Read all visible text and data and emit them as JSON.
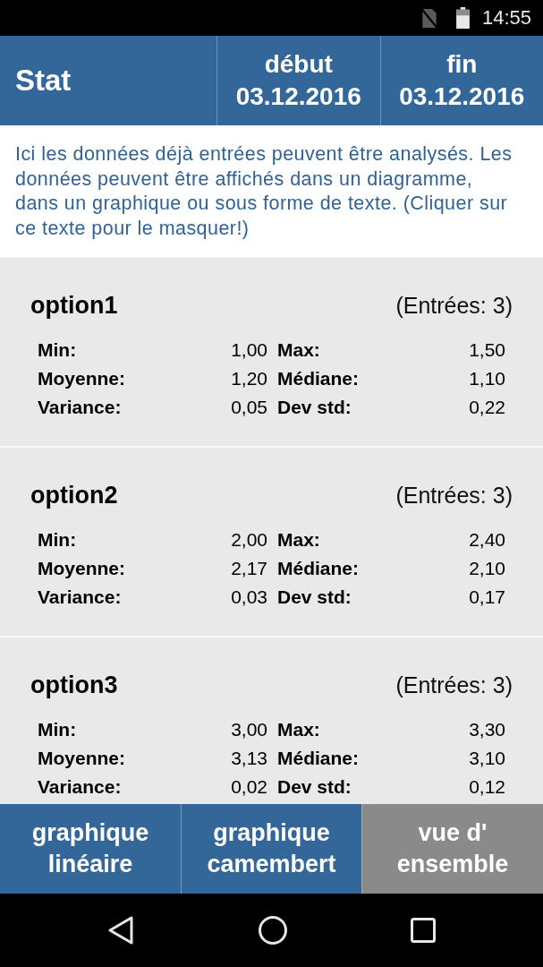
{
  "status_bar": {
    "time": "14:55"
  },
  "header": {
    "title": "Stat",
    "columns": [
      {
        "label": "début",
        "date": "03.12.2016"
      },
      {
        "label": "fin",
        "date": "03.12.2016"
      }
    ]
  },
  "info_text": "Ici les données déjà entrées peuvent être analysés. Les données peuvent être affichés dans un diagramme, dans un graphique ou sous forme de texte. (Cliquer sur ce texte pour le masquer!)",
  "options": [
    {
      "name": "option1",
      "entries": "(Entrées: 3)",
      "stats": [
        {
          "label": "Min:",
          "value": "1,00"
        },
        {
          "label": "Max:",
          "value": "1,50"
        },
        {
          "label": "Moyenne:",
          "value": "1,20"
        },
        {
          "label": "Médiane:",
          "value": "1,10"
        },
        {
          "label": "Variance:",
          "value": "0,05"
        },
        {
          "label": "Dev std:",
          "value": "0,22"
        }
      ]
    },
    {
      "name": "option2",
      "entries": "(Entrées: 3)",
      "stats": [
        {
          "label": "Min:",
          "value": "2,00"
        },
        {
          "label": "Max:",
          "value": "2,40"
        },
        {
          "label": "Moyenne:",
          "value": "2,17"
        },
        {
          "label": "Médiane:",
          "value": "2,10"
        },
        {
          "label": "Variance:",
          "value": "0,03"
        },
        {
          "label": "Dev std:",
          "value": "0,17"
        }
      ]
    },
    {
      "name": "option3",
      "entries": "(Entrées: 3)",
      "stats": [
        {
          "label": "Min:",
          "value": "3,00"
        },
        {
          "label": "Max:",
          "value": "3,30"
        },
        {
          "label": "Moyenne:",
          "value": "3,13"
        },
        {
          "label": "Médiane:",
          "value": "3,10"
        },
        {
          "label": "Variance:",
          "value": "0,02"
        },
        {
          "label": "Dev std:",
          "value": "0,12"
        }
      ]
    }
  ],
  "tabs": [
    {
      "label": "graphique linéaire",
      "selected": false
    },
    {
      "label": "graphique camembert",
      "selected": false
    },
    {
      "label": "vue d' ensemble",
      "selected": true
    }
  ]
}
